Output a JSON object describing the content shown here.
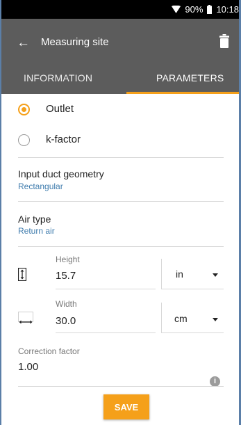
{
  "status_bar": {
    "battery": "90%",
    "time": "10:18"
  },
  "app_bar": {
    "title": "Measuring site"
  },
  "tabs": [
    {
      "label": "INFORMATION",
      "selected": false
    },
    {
      "label": "PARAMETERS",
      "selected": true
    }
  ],
  "mode_options": [
    {
      "label": "Outlet",
      "selected": true
    },
    {
      "label": "k-factor",
      "selected": false
    }
  ],
  "duct_geometry": {
    "label": "Input duct geometry",
    "value": "Rectangular"
  },
  "air_type": {
    "label": "Air type",
    "value": "Return air"
  },
  "height": {
    "label": "Height",
    "value": "15.7",
    "unit": "in"
  },
  "width": {
    "label": "Width",
    "value": "30.0",
    "unit": "cm"
  },
  "correction_factor": {
    "label": "Correction factor",
    "value": "1.00"
  },
  "save_label": "SAVE",
  "colors": {
    "accent": "#f5a01a",
    "app_bar": "#5c5c5c",
    "link": "#3f7cad"
  }
}
